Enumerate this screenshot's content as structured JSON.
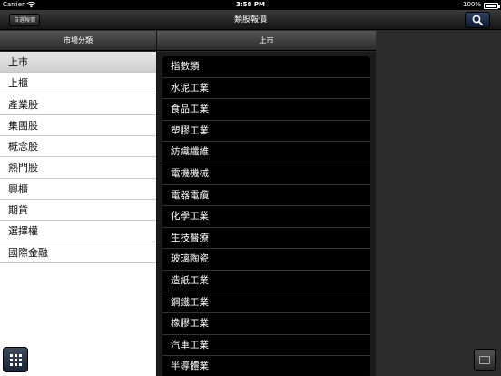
{
  "status_bar": {
    "carrier": "Carrier",
    "time": "3:58 PM",
    "battery": "100%",
    "battery_level": 1.0
  },
  "nav": {
    "left_button": "自選報價",
    "title": "類股報價"
  },
  "columns": {
    "left_header": "市場分類",
    "right_header": "上市"
  },
  "left_items": [
    "上市",
    "上櫃",
    "產業股",
    "集團股",
    "概念股",
    "熱門股",
    "興櫃",
    "期貨",
    "選擇權",
    "國際金融"
  ],
  "right_items": [
    "指數類",
    "水泥工業",
    "食品工業",
    "塑膠工業",
    "紡織纖維",
    "電機機械",
    "電器電纜",
    "化學工業",
    "生技醫療",
    "玻璃陶瓷",
    "造紙工業",
    "鋼鐵工業",
    "橡膠工業",
    "汽車工業",
    "半導體業"
  ],
  "icons": {
    "wifi": "wifi-icon",
    "search": "search-icon",
    "grid": "grid-icon",
    "bottom_right": "window-icon"
  }
}
